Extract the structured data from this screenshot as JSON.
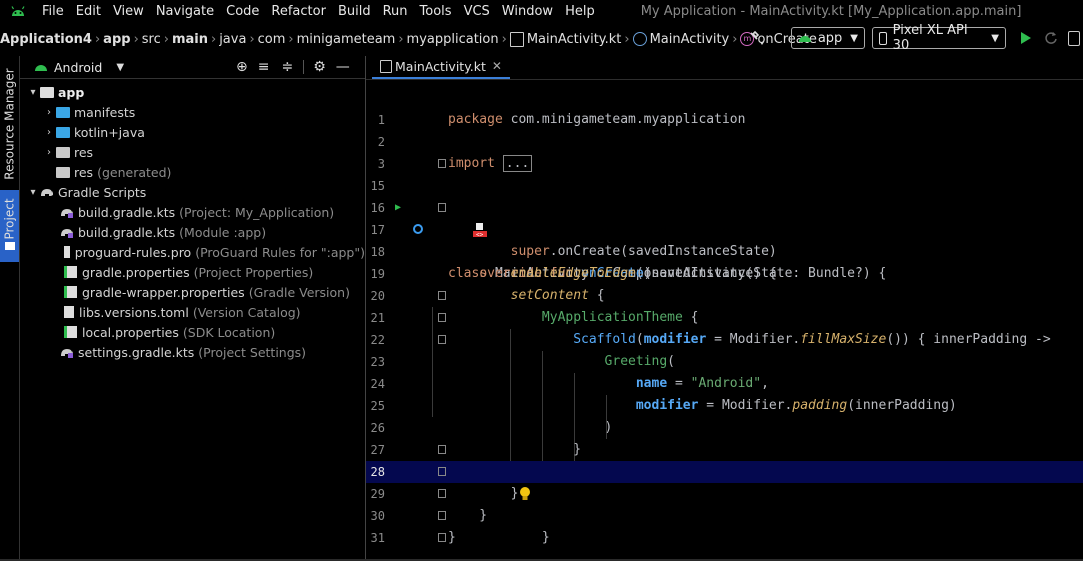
{
  "menu": {
    "items": [
      "File",
      "Edit",
      "View",
      "Navigate",
      "Code",
      "Refactor",
      "Build",
      "Run",
      "Tools",
      "VCS",
      "Window",
      "Help"
    ],
    "window_title": "My Application - MainActivity.kt [My_Application.app.main]"
  },
  "navbar": {
    "crumbs": [
      "Application4",
      "app",
      "src",
      "main",
      "java",
      "com",
      "minigameteam",
      "myapplication"
    ],
    "file": "MainActivity.kt",
    "class": "MainActivity",
    "method": "onCreate",
    "run_config": "app",
    "device": "Pixel XL API 30"
  },
  "sidebar_tabs": {
    "resource_manager": "Resource Manager",
    "project": "Project"
  },
  "project_panel": {
    "view_selector": "Android",
    "tree": [
      {
        "label": "app",
        "hint": ""
      },
      {
        "label": "manifests",
        "hint": ""
      },
      {
        "label": "kotlin+java",
        "hint": ""
      },
      {
        "label": "res",
        "hint": ""
      },
      {
        "label": "res",
        "hint": "(generated)"
      },
      {
        "label": "Gradle Scripts",
        "hint": ""
      },
      {
        "label": "build.gradle.kts",
        "hint": "(Project: My_Application)"
      },
      {
        "label": "build.gradle.kts",
        "hint": "(Module :app)"
      },
      {
        "label": "proguard-rules.pro",
        "hint": "(ProGuard Rules for \":app\")"
      },
      {
        "label": "gradle.properties",
        "hint": "(Project Properties)"
      },
      {
        "label": "gradle-wrapper.properties",
        "hint": "(Gradle Version)"
      },
      {
        "label": "libs.versions.toml",
        "hint": "(Version Catalog)"
      },
      {
        "label": "local.properties",
        "hint": "(SDK Location)"
      },
      {
        "label": "settings.gradle.kts",
        "hint": "(Project Settings)"
      }
    ]
  },
  "editor": {
    "tab_label": "MainActivity.kt",
    "current_line": "28",
    "line_numbers": [
      "1",
      "2",
      "3",
      "15",
      "16",
      "17",
      "18",
      "19",
      "20",
      "21",
      "22",
      "23",
      "24",
      "25",
      "26",
      "27",
      "28",
      "29",
      "30",
      "31"
    ],
    "lines": [
      "package com.minigameteam.myapplication",
      "",
      "import ...",
      "",
      "class MainActivity : ComponentActivity() {",
      "    override fun onCreate(savedInstanceState: Bundle?) {",
      "        super.onCreate(savedInstanceState)",
      "        enableEdgeToEdge()",
      "        setContent {",
      "            MyApplicationTheme {",
      "                Scaffold(modifier = Modifier.fillMaxSize()) { innerPadding ->",
      "                    Greeting(",
      "                        name = \"Android\",",
      "                        modifier = Modifier.padding(innerPadding)",
      "                    )",
      "                }",
      "            }",
      "        }",
      "    }",
      "}"
    ]
  },
  "colors": {
    "accent": "#2962c7",
    "current_line_bg": "#04084f",
    "keyword": "#cf8e6d",
    "function": "#56a8f5",
    "string": "#6aab73",
    "run_green": "#2fbd4f"
  }
}
